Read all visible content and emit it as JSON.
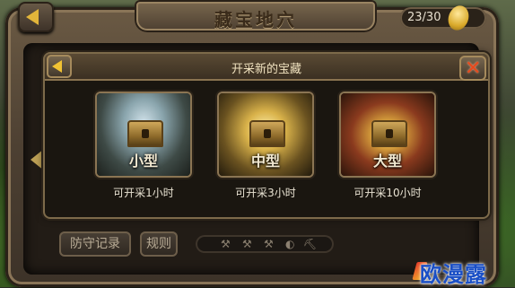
{
  "header": {
    "title": "藏宝地穴",
    "counter": "23/30",
    "back_icon": "back-arrow-icon",
    "coin_icon": "gold-coin-icon"
  },
  "dialog": {
    "title": "开采新的宝藏",
    "back_icon": "back-arrow-icon",
    "close_icon": "close-x-icon",
    "options": [
      {
        "label": "小型",
        "caption": "可开采1小时",
        "icon": "treasure-chest-icon"
      },
      {
        "label": "中型",
        "caption": "可开采3小时",
        "icon": "treasure-chest-icon"
      },
      {
        "label": "大型",
        "caption": "可开采10小时",
        "icon": "treasure-chest-icon"
      }
    ]
  },
  "bottom": {
    "defense_log": "防守记录",
    "rules": "规则",
    "tools": [
      "shovel-icon",
      "shovel-icon",
      "shovel-icon",
      "helmet-icon",
      "pickaxe-icon"
    ]
  },
  "watermark": "欧漫露",
  "colors": {
    "accent_gold": "#e2b53a",
    "close_red": "#e54a1e",
    "watermark_blue": "#1a4fc6"
  }
}
